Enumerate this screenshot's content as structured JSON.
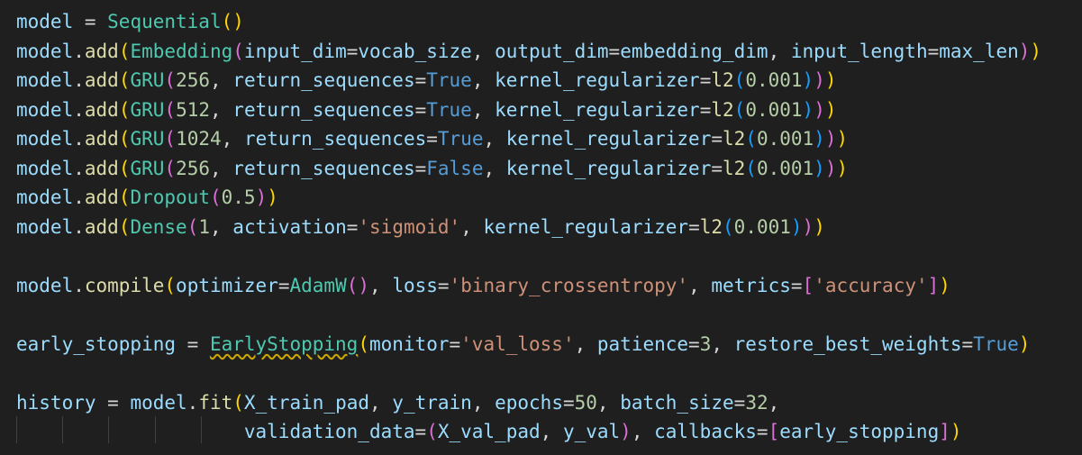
{
  "editor": {
    "language": "python",
    "theme": "dark",
    "lines": [
      [
        [
          "v",
          "model"
        ],
        [
          "p",
          " = "
        ],
        [
          "c",
          "Sequential"
        ],
        [
          "b1",
          "()"
        ]
      ],
      [
        [
          "v",
          "model"
        ],
        [
          "p",
          "."
        ],
        [
          "f",
          "add"
        ],
        [
          "b1",
          "("
        ],
        [
          "c",
          "Embedding"
        ],
        [
          "b2",
          "("
        ],
        [
          "v",
          "input_dim"
        ],
        [
          "p",
          "="
        ],
        [
          "v",
          "vocab_size"
        ],
        [
          "p",
          ", "
        ],
        [
          "v",
          "output_dim"
        ],
        [
          "p",
          "="
        ],
        [
          "v",
          "embedding_dim"
        ],
        [
          "p",
          ", "
        ],
        [
          "v",
          "input_length"
        ],
        [
          "p",
          "="
        ],
        [
          "v",
          "max_len"
        ],
        [
          "b2",
          ")"
        ],
        [
          "b1",
          ")"
        ]
      ],
      [
        [
          "v",
          "model"
        ],
        [
          "p",
          "."
        ],
        [
          "f",
          "add"
        ],
        [
          "b1",
          "("
        ],
        [
          "c",
          "GRU"
        ],
        [
          "b2",
          "("
        ],
        [
          "n",
          "256"
        ],
        [
          "p",
          ", "
        ],
        [
          "v",
          "return_sequences"
        ],
        [
          "p",
          "="
        ],
        [
          "k",
          "True"
        ],
        [
          "p",
          ", "
        ],
        [
          "v",
          "kernel_regularizer"
        ],
        [
          "p",
          "="
        ],
        [
          "f",
          "l2"
        ],
        [
          "b3",
          "("
        ],
        [
          "n",
          "0.001"
        ],
        [
          "b3",
          ")"
        ],
        [
          "b2",
          ")"
        ],
        [
          "b1",
          ")"
        ]
      ],
      [
        [
          "v",
          "model"
        ],
        [
          "p",
          "."
        ],
        [
          "f",
          "add"
        ],
        [
          "b1",
          "("
        ],
        [
          "c",
          "GRU"
        ],
        [
          "b2",
          "("
        ],
        [
          "n",
          "512"
        ],
        [
          "p",
          ", "
        ],
        [
          "v",
          "return_sequences"
        ],
        [
          "p",
          "="
        ],
        [
          "k",
          "True"
        ],
        [
          "p",
          ", "
        ],
        [
          "v",
          "kernel_regularizer"
        ],
        [
          "p",
          "="
        ],
        [
          "f",
          "l2"
        ],
        [
          "b3",
          "("
        ],
        [
          "n",
          "0.001"
        ],
        [
          "b3",
          ")"
        ],
        [
          "b2",
          ")"
        ],
        [
          "b1",
          ")"
        ]
      ],
      [
        [
          "v",
          "model"
        ],
        [
          "p",
          "."
        ],
        [
          "f",
          "add"
        ],
        [
          "b1",
          "("
        ],
        [
          "c",
          "GRU"
        ],
        [
          "b2",
          "("
        ],
        [
          "n",
          "1024"
        ],
        [
          "p",
          ", "
        ],
        [
          "v",
          "return_sequences"
        ],
        [
          "p",
          "="
        ],
        [
          "k",
          "True"
        ],
        [
          "p",
          ", "
        ],
        [
          "v",
          "kernel_regularizer"
        ],
        [
          "p",
          "="
        ],
        [
          "f",
          "l2"
        ],
        [
          "b3",
          "("
        ],
        [
          "n",
          "0.001"
        ],
        [
          "b3",
          ")"
        ],
        [
          "b2",
          ")"
        ],
        [
          "b1",
          ")"
        ]
      ],
      [
        [
          "v",
          "model"
        ],
        [
          "p",
          "."
        ],
        [
          "f",
          "add"
        ],
        [
          "b1",
          "("
        ],
        [
          "c",
          "GRU"
        ],
        [
          "b2",
          "("
        ],
        [
          "n",
          "256"
        ],
        [
          "p",
          ", "
        ],
        [
          "v",
          "return_sequences"
        ],
        [
          "p",
          "="
        ],
        [
          "k",
          "False"
        ],
        [
          "p",
          ", "
        ],
        [
          "v",
          "kernel_regularizer"
        ],
        [
          "p",
          "="
        ],
        [
          "f",
          "l2"
        ],
        [
          "b3",
          "("
        ],
        [
          "n",
          "0.001"
        ],
        [
          "b3",
          ")"
        ],
        [
          "b2",
          ")"
        ],
        [
          "b1",
          ")"
        ]
      ],
      [
        [
          "v",
          "model"
        ],
        [
          "p",
          "."
        ],
        [
          "f",
          "add"
        ],
        [
          "b1",
          "("
        ],
        [
          "c",
          "Dropout"
        ],
        [
          "b2",
          "("
        ],
        [
          "n",
          "0.5"
        ],
        [
          "b2",
          ")"
        ],
        [
          "b1",
          ")"
        ]
      ],
      [
        [
          "v",
          "model"
        ],
        [
          "p",
          "."
        ],
        [
          "f",
          "add"
        ],
        [
          "b1",
          "("
        ],
        [
          "c",
          "Dense"
        ],
        [
          "b2",
          "("
        ],
        [
          "n",
          "1"
        ],
        [
          "p",
          ", "
        ],
        [
          "v",
          "activation"
        ],
        [
          "p",
          "="
        ],
        [
          "s",
          "'sigmoid'"
        ],
        [
          "p",
          ", "
        ],
        [
          "v",
          "kernel_regularizer"
        ],
        [
          "p",
          "="
        ],
        [
          "f",
          "l2"
        ],
        [
          "b3",
          "("
        ],
        [
          "n",
          "0.001"
        ],
        [
          "b3",
          ")"
        ],
        [
          "b2",
          ")"
        ],
        [
          "b1",
          ")"
        ]
      ],
      [],
      [
        [
          "v",
          "model"
        ],
        [
          "p",
          "."
        ],
        [
          "f",
          "compile"
        ],
        [
          "b1",
          "("
        ],
        [
          "v",
          "optimizer"
        ],
        [
          "p",
          "="
        ],
        [
          "c",
          "AdamW"
        ],
        [
          "b2",
          "()"
        ],
        [
          "p",
          ", "
        ],
        [
          "v",
          "loss"
        ],
        [
          "p",
          "="
        ],
        [
          "s",
          "'binary_crossentropy'"
        ],
        [
          "p",
          ", "
        ],
        [
          "v",
          "metrics"
        ],
        [
          "p",
          "="
        ],
        [
          "b2",
          "["
        ],
        [
          "s",
          "'accuracy'"
        ],
        [
          "b2",
          "]"
        ],
        [
          "b1",
          ")"
        ]
      ],
      [],
      [
        [
          "v",
          "early_stopping"
        ],
        [
          "p",
          " = "
        ],
        [
          "c",
          "EarlyStopping",
          "squiggle"
        ],
        [
          "b1",
          "("
        ],
        [
          "v",
          "monitor"
        ],
        [
          "p",
          "="
        ],
        [
          "s",
          "'val_loss'"
        ],
        [
          "p",
          ", "
        ],
        [
          "v",
          "patience"
        ],
        [
          "p",
          "="
        ],
        [
          "n",
          "3"
        ],
        [
          "p",
          ", "
        ],
        [
          "v",
          "restore_best_weights"
        ],
        [
          "p",
          "="
        ],
        [
          "k",
          "True"
        ],
        [
          "b1",
          ")"
        ]
      ],
      [],
      [
        [
          "v",
          "history"
        ],
        [
          "p",
          " = "
        ],
        [
          "v",
          "model"
        ],
        [
          "p",
          "."
        ],
        [
          "f",
          "fit"
        ],
        [
          "b1",
          "("
        ],
        [
          "v",
          "X_train_pad"
        ],
        [
          "p",
          ", "
        ],
        [
          "v",
          "y_train"
        ],
        [
          "p",
          ", "
        ],
        [
          "v",
          "epochs"
        ],
        [
          "p",
          "="
        ],
        [
          "n",
          "50"
        ],
        [
          "p",
          ", "
        ],
        [
          "v",
          "batch_size"
        ],
        [
          "p",
          "="
        ],
        [
          "n",
          "32"
        ],
        [
          "p",
          ","
        ]
      ],
      [
        [
          "p",
          "                    "
        ],
        [
          "v",
          "validation_data"
        ],
        [
          "p",
          "="
        ],
        [
          "b2",
          "("
        ],
        [
          "v",
          "X_val_pad"
        ],
        [
          "p",
          ", "
        ],
        [
          "v",
          "y_val"
        ],
        [
          "b2",
          ")"
        ],
        [
          "p",
          ", "
        ],
        [
          "v",
          "callbacks"
        ],
        [
          "p",
          "="
        ],
        [
          "b2",
          "["
        ],
        [
          "v",
          "early_stopping"
        ],
        [
          "b2",
          "]"
        ],
        [
          "b1",
          ")"
        ]
      ]
    ],
    "indent_guides": 5,
    "diagnostic": {
      "token": "EarlyStopping",
      "severity": "warning",
      "color": "#cca700"
    }
  },
  "colors": {
    "background": "#1f1f1f",
    "variable": "#9cdcfe",
    "function": "#dcdcaa",
    "class": "#4ec9b0",
    "number": "#b5cea8",
    "keyword": "#569cd6",
    "string": "#ce9178",
    "bracket_level_1": "#ffd700",
    "bracket_level_2": "#da70d6",
    "bracket_level_3": "#179fff"
  }
}
